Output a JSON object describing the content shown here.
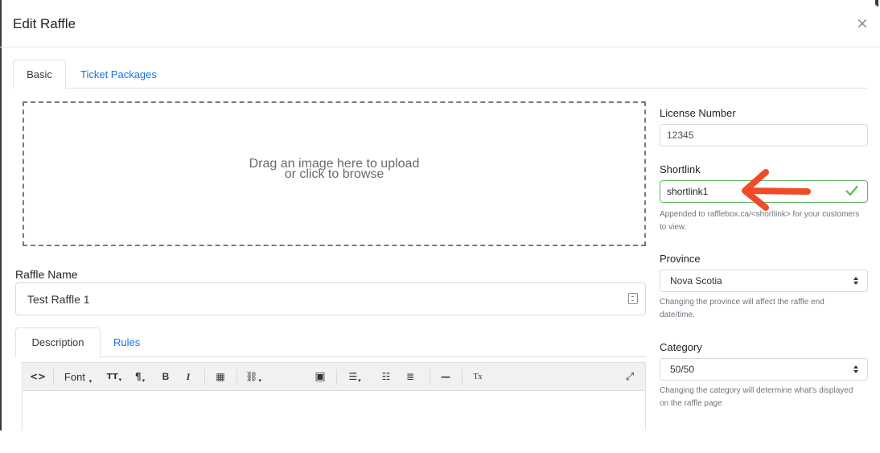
{
  "modal": {
    "title": "Edit Raffle",
    "close_glyph": "×"
  },
  "tabs": [
    {
      "label": "Basic",
      "active": true
    },
    {
      "label": "Ticket Packages",
      "active": false
    }
  ],
  "dropzone": {
    "line1": "Drag an image here to upload",
    "line2": "or click to browse"
  },
  "raffle_name": {
    "label": "Raffle Name",
    "value": "Test Raffle 1"
  },
  "content_tabs": [
    {
      "label": "Description",
      "active": true
    },
    {
      "label": "Rules",
      "active": false
    }
  ],
  "editor": {
    "toolbar": {
      "code": "<>",
      "font": "Font",
      "font_caret": "▾",
      "text_size": "TT",
      "paragraph": "¶",
      "bold": "B",
      "italic": "I",
      "table": "▦",
      "link": "⛓",
      "image": "▣",
      "align": "☰",
      "unordered_list": "☷",
      "ordered_list": "≣",
      "rule": "—",
      "clear_format": "Tx",
      "fullscreen": "⤢",
      "sub_caret": "▾"
    },
    "icons": [
      "code-view-icon",
      "font-family-icon",
      "font-size-icon",
      "paragraph-icon",
      "bold-icon",
      "italic-icon",
      "table-icon",
      "link-icon",
      "image-icon",
      "align-icon",
      "bullet-list-icon",
      "numbered-list-icon",
      "horizontal-rule-icon",
      "clear-format-icon",
      "fullscreen-icon"
    ]
  },
  "license": {
    "label": "License Number",
    "value": "12345"
  },
  "shortlink": {
    "label": "Shortlink",
    "value": "shortlink1",
    "help": "Appended to rafflebox.ca/<shortlink> for your customers to view.",
    "status": "valid"
  },
  "province": {
    "label": "Province",
    "selected": "Nova Scotia",
    "help": "Changing the province will affect the raffle end date/time."
  },
  "category": {
    "label": "Category",
    "selected": "50/50",
    "help": "Changing the category will determine what's displayed on the raffle page"
  },
  "colors": {
    "link_blue": "#1a73e8",
    "valid_green": "#5cb85c",
    "annotation_arrow": "#ef4b28"
  }
}
